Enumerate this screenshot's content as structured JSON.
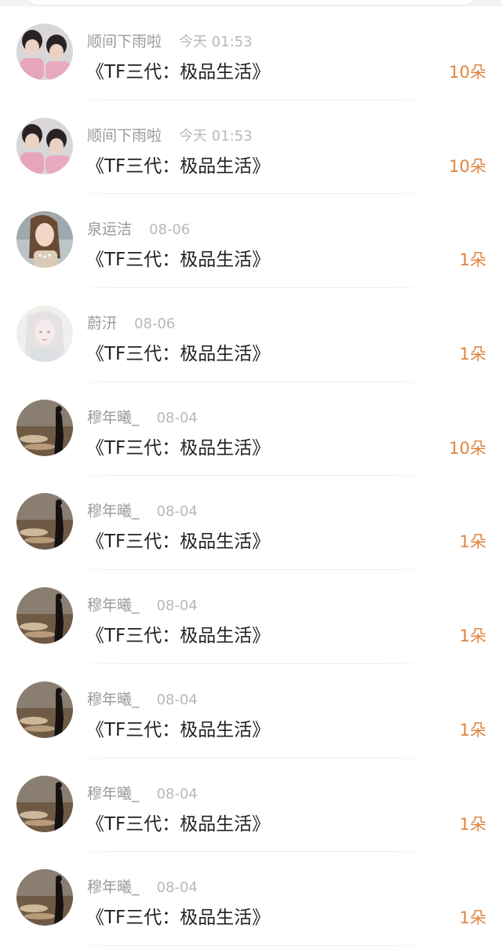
{
  "colors": {
    "accent": "#e08540",
    "name": "#9a9a9a",
    "title": "#222222"
  },
  "rows": [
    {
      "user": "顺间下雨啦",
      "time": "今天 01:53",
      "title": "《TF三代：极品生活》",
      "amount": "10朵",
      "avatar": "avatar-couple"
    },
    {
      "user": "顺间下雨啦",
      "time": "今天 01:53",
      "title": "《TF三代：极品生活》",
      "amount": "10朵",
      "avatar": "avatar-couple"
    },
    {
      "user": "泉运洁",
      "time": "08-06",
      "title": "《TF三代：极品生活》",
      "amount": "1朵",
      "avatar": "avatar-girl"
    },
    {
      "user": "蔚汧",
      "time": "08-06",
      "title": "《TF三代：极品生活》",
      "amount": "1朵",
      "avatar": "avatar-anime"
    },
    {
      "user": "穆年曦_",
      "time": "08-04",
      "title": "《TF三代：极品生活》",
      "amount": "10朵",
      "avatar": "avatar-beach"
    },
    {
      "user": "穆年曦_",
      "time": "08-04",
      "title": "《TF三代：极品生活》",
      "amount": "1朵",
      "avatar": "avatar-beach"
    },
    {
      "user": "穆年曦_",
      "time": "08-04",
      "title": "《TF三代：极品生活》",
      "amount": "1朵",
      "avatar": "avatar-beach"
    },
    {
      "user": "穆年曦_",
      "time": "08-04",
      "title": "《TF三代：极品生活》",
      "amount": "1朵",
      "avatar": "avatar-beach"
    },
    {
      "user": "穆年曦_",
      "time": "08-04",
      "title": "《TF三代：极品生活》",
      "amount": "1朵",
      "avatar": "avatar-beach"
    },
    {
      "user": "穆年曦_",
      "time": "08-04",
      "title": "《TF三代：极品生活》",
      "amount": "1朵",
      "avatar": "avatar-beach"
    }
  ]
}
